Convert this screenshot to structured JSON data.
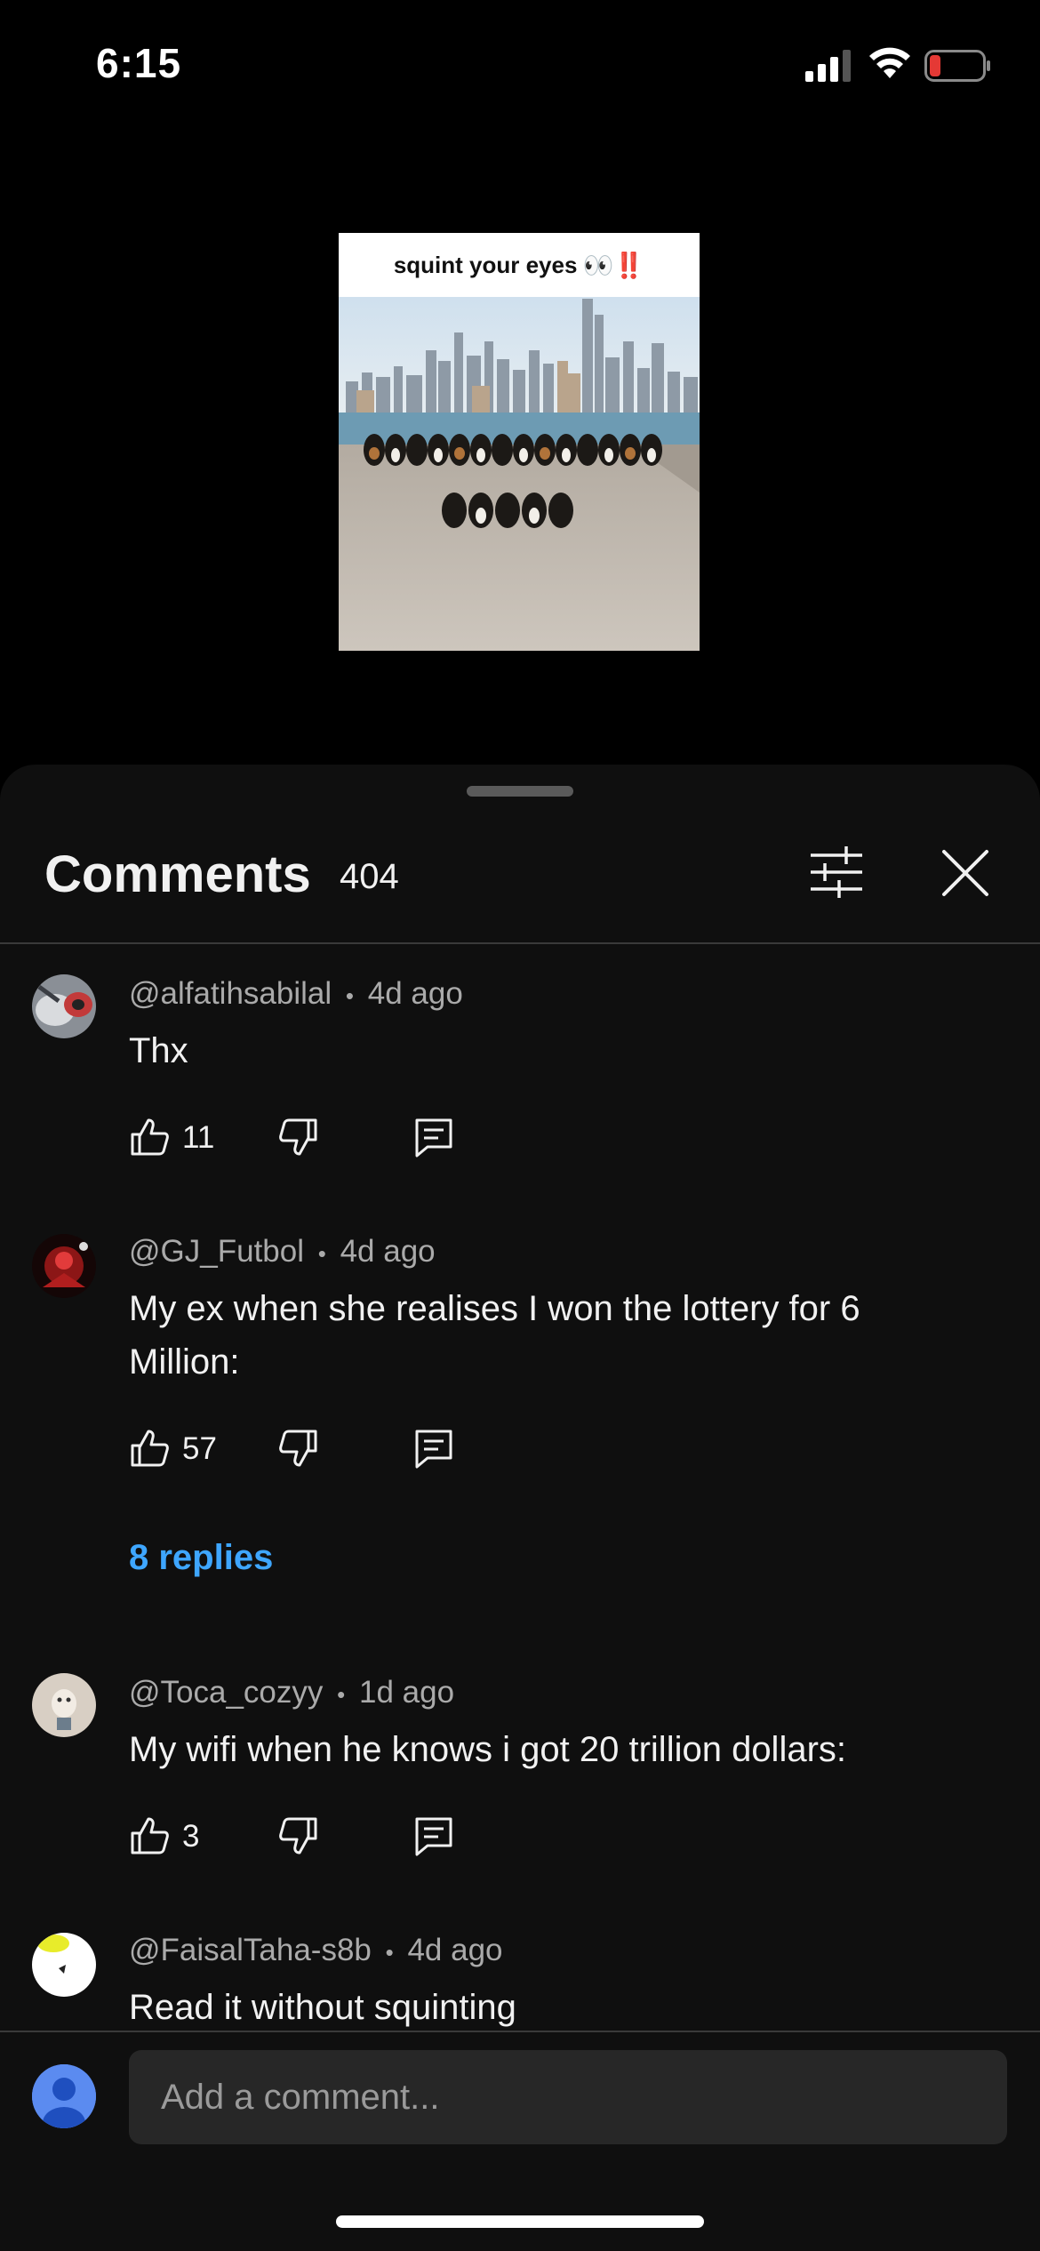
{
  "status_bar": {
    "time": "6:15",
    "icons": [
      "signal-icon",
      "wifi-icon",
      "battery-low-icon"
    ],
    "battery_color": "#e53935"
  },
  "video": {
    "caption": "squint your eyes",
    "caption_emoji": "👀‼️"
  },
  "comments_panel": {
    "title": "Comments",
    "count": "404",
    "icons": [
      "filter-sliders-icon",
      "close-icon"
    ]
  },
  "comments": [
    {
      "author": "@alfatihsabilal",
      "separator": "•",
      "age": "4d ago",
      "text": "Thx",
      "likes": "11"
    },
    {
      "author": "@GJ_Futbol",
      "separator": "•",
      "age": "4d ago",
      "text": "My ex when she realises I won the lottery for 6 Million:",
      "likes": "57",
      "replies_label": "8 replies"
    },
    {
      "author": "@Toca_cozyy",
      "separator": "•",
      "age": "1d ago",
      "text": "My wifi when he knows i got 20 trillion dollars:",
      "likes": "3"
    },
    {
      "author": "@FaisalTaha-s8b",
      "separator": "•",
      "age": "4d ago",
      "text": "Read it without squinting"
    }
  ],
  "composer": {
    "placeholder": "Add a comment..."
  },
  "colors": {
    "accent_link": "#3ea6ff",
    "sheet_bg": "#0f0f0f",
    "input_bg": "#272727"
  }
}
